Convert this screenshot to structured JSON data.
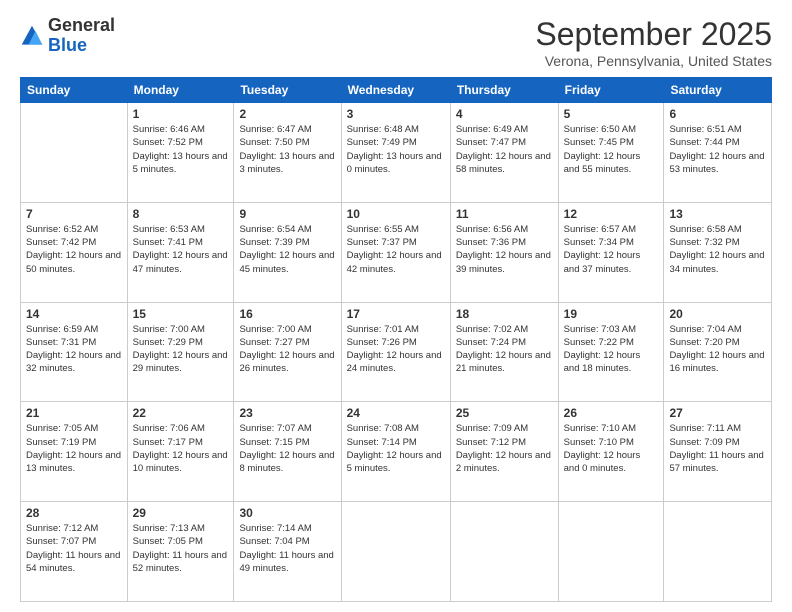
{
  "header": {
    "logo": {
      "general": "General",
      "blue": "Blue"
    },
    "title": "September 2025",
    "location": "Verona, Pennsylvania, United States"
  },
  "weekdays": [
    "Sunday",
    "Monday",
    "Tuesday",
    "Wednesday",
    "Thursday",
    "Friday",
    "Saturday"
  ],
  "weeks": [
    [
      {
        "day": "",
        "sunrise": "",
        "sunset": "",
        "daylight": ""
      },
      {
        "day": "1",
        "sunrise": "Sunrise: 6:46 AM",
        "sunset": "Sunset: 7:52 PM",
        "daylight": "Daylight: 13 hours and 5 minutes."
      },
      {
        "day": "2",
        "sunrise": "Sunrise: 6:47 AM",
        "sunset": "Sunset: 7:50 PM",
        "daylight": "Daylight: 13 hours and 3 minutes."
      },
      {
        "day": "3",
        "sunrise": "Sunrise: 6:48 AM",
        "sunset": "Sunset: 7:49 PM",
        "daylight": "Daylight: 13 hours and 0 minutes."
      },
      {
        "day": "4",
        "sunrise": "Sunrise: 6:49 AM",
        "sunset": "Sunset: 7:47 PM",
        "daylight": "Daylight: 12 hours and 58 minutes."
      },
      {
        "day": "5",
        "sunrise": "Sunrise: 6:50 AM",
        "sunset": "Sunset: 7:45 PM",
        "daylight": "Daylight: 12 hours and 55 minutes."
      },
      {
        "day": "6",
        "sunrise": "Sunrise: 6:51 AM",
        "sunset": "Sunset: 7:44 PM",
        "daylight": "Daylight: 12 hours and 53 minutes."
      }
    ],
    [
      {
        "day": "7",
        "sunrise": "Sunrise: 6:52 AM",
        "sunset": "Sunset: 7:42 PM",
        "daylight": "Daylight: 12 hours and 50 minutes."
      },
      {
        "day": "8",
        "sunrise": "Sunrise: 6:53 AM",
        "sunset": "Sunset: 7:41 PM",
        "daylight": "Daylight: 12 hours and 47 minutes."
      },
      {
        "day": "9",
        "sunrise": "Sunrise: 6:54 AM",
        "sunset": "Sunset: 7:39 PM",
        "daylight": "Daylight: 12 hours and 45 minutes."
      },
      {
        "day": "10",
        "sunrise": "Sunrise: 6:55 AM",
        "sunset": "Sunset: 7:37 PM",
        "daylight": "Daylight: 12 hours and 42 minutes."
      },
      {
        "day": "11",
        "sunrise": "Sunrise: 6:56 AM",
        "sunset": "Sunset: 7:36 PM",
        "daylight": "Daylight: 12 hours and 39 minutes."
      },
      {
        "day": "12",
        "sunrise": "Sunrise: 6:57 AM",
        "sunset": "Sunset: 7:34 PM",
        "daylight": "Daylight: 12 hours and 37 minutes."
      },
      {
        "day": "13",
        "sunrise": "Sunrise: 6:58 AM",
        "sunset": "Sunset: 7:32 PM",
        "daylight": "Daylight: 12 hours and 34 minutes."
      }
    ],
    [
      {
        "day": "14",
        "sunrise": "Sunrise: 6:59 AM",
        "sunset": "Sunset: 7:31 PM",
        "daylight": "Daylight: 12 hours and 32 minutes."
      },
      {
        "day": "15",
        "sunrise": "Sunrise: 7:00 AM",
        "sunset": "Sunset: 7:29 PM",
        "daylight": "Daylight: 12 hours and 29 minutes."
      },
      {
        "day": "16",
        "sunrise": "Sunrise: 7:00 AM",
        "sunset": "Sunset: 7:27 PM",
        "daylight": "Daylight: 12 hours and 26 minutes."
      },
      {
        "day": "17",
        "sunrise": "Sunrise: 7:01 AM",
        "sunset": "Sunset: 7:26 PM",
        "daylight": "Daylight: 12 hours and 24 minutes."
      },
      {
        "day": "18",
        "sunrise": "Sunrise: 7:02 AM",
        "sunset": "Sunset: 7:24 PM",
        "daylight": "Daylight: 12 hours and 21 minutes."
      },
      {
        "day": "19",
        "sunrise": "Sunrise: 7:03 AM",
        "sunset": "Sunset: 7:22 PM",
        "daylight": "Daylight: 12 hours and 18 minutes."
      },
      {
        "day": "20",
        "sunrise": "Sunrise: 7:04 AM",
        "sunset": "Sunset: 7:20 PM",
        "daylight": "Daylight: 12 hours and 16 minutes."
      }
    ],
    [
      {
        "day": "21",
        "sunrise": "Sunrise: 7:05 AM",
        "sunset": "Sunset: 7:19 PM",
        "daylight": "Daylight: 12 hours and 13 minutes."
      },
      {
        "day": "22",
        "sunrise": "Sunrise: 7:06 AM",
        "sunset": "Sunset: 7:17 PM",
        "daylight": "Daylight: 12 hours and 10 minutes."
      },
      {
        "day": "23",
        "sunrise": "Sunrise: 7:07 AM",
        "sunset": "Sunset: 7:15 PM",
        "daylight": "Daylight: 12 hours and 8 minutes."
      },
      {
        "day": "24",
        "sunrise": "Sunrise: 7:08 AM",
        "sunset": "Sunset: 7:14 PM",
        "daylight": "Daylight: 12 hours and 5 minutes."
      },
      {
        "day": "25",
        "sunrise": "Sunrise: 7:09 AM",
        "sunset": "Sunset: 7:12 PM",
        "daylight": "Daylight: 12 hours and 2 minutes."
      },
      {
        "day": "26",
        "sunrise": "Sunrise: 7:10 AM",
        "sunset": "Sunset: 7:10 PM",
        "daylight": "Daylight: 12 hours and 0 minutes."
      },
      {
        "day": "27",
        "sunrise": "Sunrise: 7:11 AM",
        "sunset": "Sunset: 7:09 PM",
        "daylight": "Daylight: 11 hours and 57 minutes."
      }
    ],
    [
      {
        "day": "28",
        "sunrise": "Sunrise: 7:12 AM",
        "sunset": "Sunset: 7:07 PM",
        "daylight": "Daylight: 11 hours and 54 minutes."
      },
      {
        "day": "29",
        "sunrise": "Sunrise: 7:13 AM",
        "sunset": "Sunset: 7:05 PM",
        "daylight": "Daylight: 11 hours and 52 minutes."
      },
      {
        "day": "30",
        "sunrise": "Sunrise: 7:14 AM",
        "sunset": "Sunset: 7:04 PM",
        "daylight": "Daylight: 11 hours and 49 minutes."
      },
      {
        "day": "",
        "sunrise": "",
        "sunset": "",
        "daylight": ""
      },
      {
        "day": "",
        "sunrise": "",
        "sunset": "",
        "daylight": ""
      },
      {
        "day": "",
        "sunrise": "",
        "sunset": "",
        "daylight": ""
      },
      {
        "day": "",
        "sunrise": "",
        "sunset": "",
        "daylight": ""
      }
    ]
  ]
}
